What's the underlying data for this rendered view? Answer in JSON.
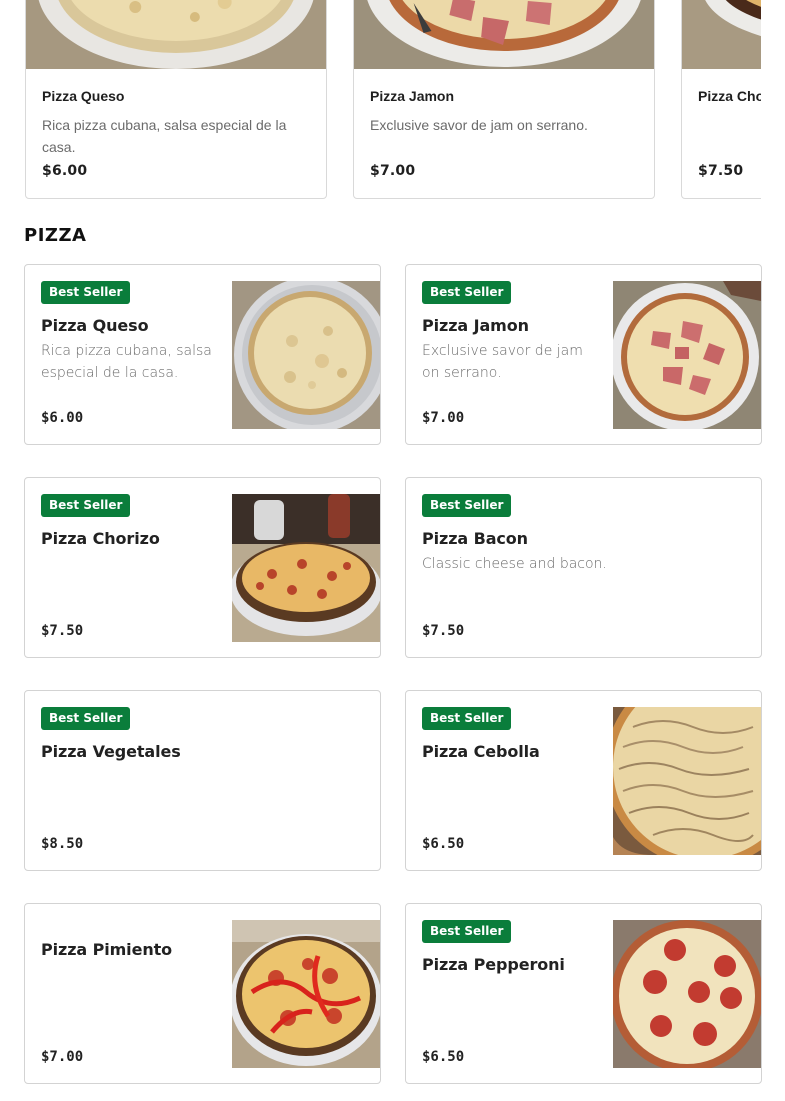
{
  "carousel": {
    "items": [
      {
        "name": "Pizza Queso",
        "description": "Rica pizza cubana, salsa especial de la casa.",
        "price": "$6.00",
        "image": "pizza-queso-photo"
      },
      {
        "name": "Pizza Jamon",
        "description": "Exclusive savor de jam on serrano.",
        "price": "$7.00",
        "image": "pizza-jamon-photo"
      },
      {
        "name": "Pizza Cho",
        "description": "",
        "price": "$7.50",
        "image": "pizza-chorizo-photo"
      }
    ]
  },
  "section": {
    "title": "PIZZA"
  },
  "badge_label": "Best Seller",
  "colors": {
    "badge_bg": "#0a7d3b",
    "card_border": "#d3d3d3",
    "desc_text": "#6b6b6b"
  },
  "menu": {
    "items": [
      {
        "name": "Pizza Queso",
        "description": "Rica pizza cubana, salsa especial de la casa.",
        "price": "$6.00",
        "best_seller": true,
        "image": "pizza-queso-photo"
      },
      {
        "name": "Pizza Jamon",
        "description": "Exclusive savor de jam on serrano.",
        "price": "$7.00",
        "best_seller": true,
        "image": "pizza-jamon-photo"
      },
      {
        "name": "Pizza Chorizo",
        "description": "",
        "price": "$7.50",
        "best_seller": true,
        "image": "pizza-chorizo-photo"
      },
      {
        "name": "Pizza Bacon",
        "description": "Classic cheese and bacon.",
        "price": "$7.50",
        "best_seller": true,
        "image": ""
      },
      {
        "name": "Pizza Vegetales",
        "description": "",
        "price": "$8.50",
        "best_seller": true,
        "image": ""
      },
      {
        "name": "Pizza Cebolla",
        "description": "",
        "price": "$6.50",
        "best_seller": true,
        "image": "pizza-cebolla-photo"
      },
      {
        "name": "Pizza Pimiento",
        "description": "",
        "price": "$7.00",
        "best_seller": false,
        "image": "pizza-pimiento-photo"
      },
      {
        "name": "Pizza Pepperoni",
        "description": "",
        "price": "$6.50",
        "best_seller": true,
        "image": "pizza-pepperoni-photo"
      }
    ]
  }
}
